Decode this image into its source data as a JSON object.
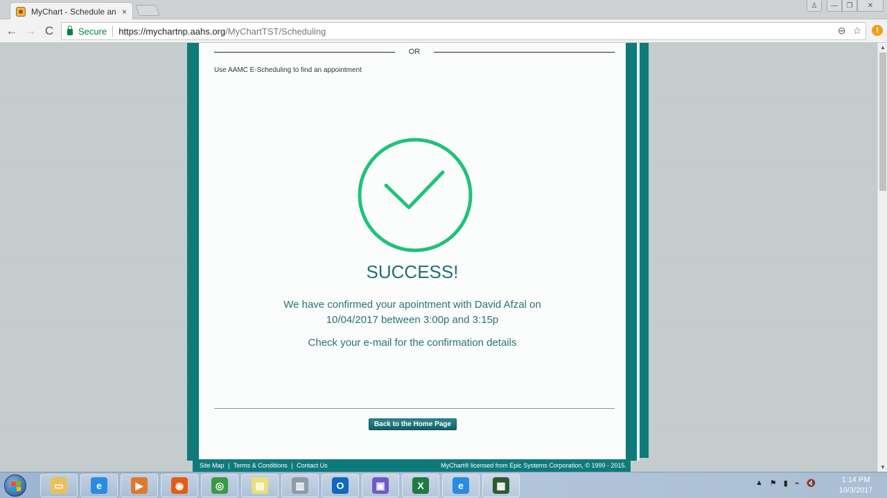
{
  "browser": {
    "tab_title": "MyChart - Schedule an Appointment",
    "tab_close": "×",
    "secure_label": "Secure",
    "url_host": "https://mychartnp.aahs.org",
    "url_path": "/MyChartTST/Scheduling",
    "zoom_icon": "⊖",
    "star_icon": "☆",
    "extension_badge": "!",
    "nav": {
      "back": "←",
      "forward": "→",
      "reload": "C"
    },
    "window_controls": {
      "user": "♙",
      "minimize": "—",
      "maximize": "❐",
      "close": "✕"
    }
  },
  "page": {
    "or_label": "OR",
    "escheduling_text": "Use AAMC E-Scheduling to find an appointment",
    "success_title": "SUCCESS!",
    "confirm_line1": "We have confirmed your apointment with David Afzal on",
    "confirm_line2": "10/04/2017 between 3:00p and 3:15p",
    "email_note": "Check your e-mail for the confirmation details",
    "home_button": "Back to the Home Page",
    "colors": {
      "teal": "#0f7a7a",
      "success_green": "#1ec27a",
      "title_teal": "#1e6f76"
    }
  },
  "footer": {
    "links": [
      "Site Map",
      "Terms & Conditions",
      "Contact Us"
    ],
    "separator": "|",
    "copyright": "MyChart® licensed from Epic Systems Corporation, © 1999 - 2015."
  },
  "taskbar": {
    "items": [
      {
        "name": "file-explorer",
        "glyph": "▭",
        "color": "#e8c15a"
      },
      {
        "name": "internet-explorer",
        "glyph": "e",
        "color": "#2a8be0"
      },
      {
        "name": "media-player",
        "glyph": "▶",
        "color": "#e0782a"
      },
      {
        "name": "firefox",
        "glyph": "◉",
        "color": "#e55b13"
      },
      {
        "name": "chrome",
        "glyph": "◎",
        "color": "#3b9a44"
      },
      {
        "name": "sticky-notes",
        "glyph": "▤",
        "color": "#e9e07a"
      },
      {
        "name": "document-app",
        "glyph": "▥",
        "color": "#8f9ba6"
      },
      {
        "name": "outlook",
        "glyph": "O",
        "color": "#1168bf"
      },
      {
        "name": "remote-desktop",
        "glyph": "▣",
        "color": "#6f5bc4"
      },
      {
        "name": "excel",
        "glyph": "X",
        "color": "#1f7a43"
      },
      {
        "name": "internet-explorer-2",
        "glyph": "e",
        "color": "#2a8be0"
      },
      {
        "name": "system-monitor",
        "glyph": "▦",
        "color": "#2f5a33"
      }
    ],
    "tray": [
      "▲",
      "⚑",
      "▮",
      "⌁",
      "🔇"
    ],
    "time": "1:14 PM",
    "date": "10/3/2017"
  }
}
